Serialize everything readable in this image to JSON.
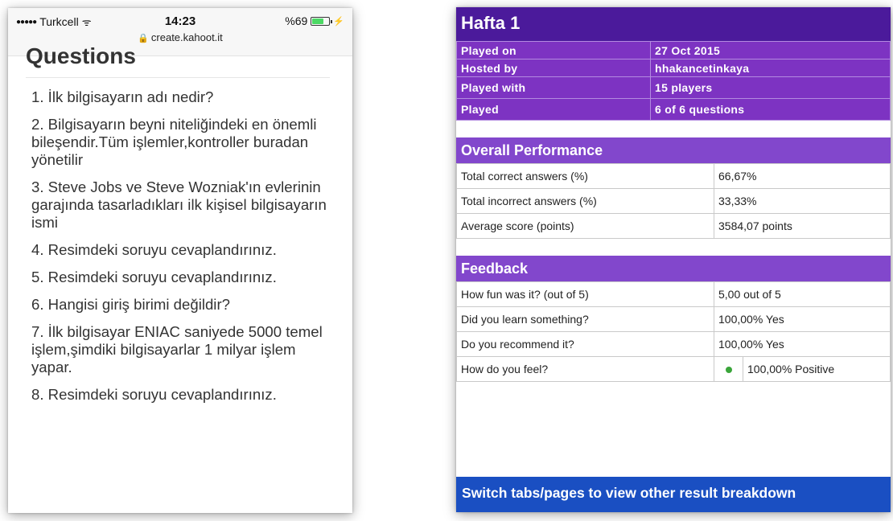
{
  "phone": {
    "status": {
      "carrier": "Turkcell",
      "time": "14:23",
      "battery": "%69",
      "battery_level": 0.69,
      "url": "create.kahoot.it"
    },
    "heading": "Questions",
    "questions": [
      "1. İlk bilgisayarın adı nedir?",
      "2. Bilgisayarın beyni niteliğindeki en önemli bileşendir.Tüm işlemler,kontroller buradan yönetilir",
      "3. Steve Jobs ve Steve Wozniak'ın evlerinin garajında tasarladıkları ilk kişisel bilgisayarın ismi",
      "4. Resimdeki soruyu cevaplandırınız.",
      "5. Resimdeki soruyu cevaplandırınız.",
      "6. Hangisi giriş birimi değildir?",
      "7. İlk bilgisayar ENIAC saniyede 5000 temel işlem,şimdiki bilgisayarlar 1 milyar işlem yapar.",
      "8. Resimdeki soruyu cevaplandırınız."
    ]
  },
  "report": {
    "title": "Hafta 1",
    "meta": [
      {
        "label": "Played on",
        "value": "27 Oct 2015"
      },
      {
        "label": "Hosted by",
        "value": "hhakancetinkaya"
      },
      {
        "label": "Played with",
        "value": "15 players"
      },
      {
        "label": "Played",
        "value": "6 of 6 questions"
      }
    ],
    "performance": {
      "title": "Overall Performance",
      "rows": [
        {
          "label": "Total correct answers (%)",
          "value": "66,67%"
        },
        {
          "label": "Total incorrect answers (%)",
          "value": "33,33%"
        },
        {
          "label": "Average score (points)",
          "value": "3584,07 points"
        }
      ]
    },
    "feedback": {
      "title": "Feedback",
      "rows": [
        {
          "label": "How fun was it? (out of 5)",
          "value": "5,00 out of 5"
        },
        {
          "label": "Did you learn something?",
          "value": "100,00% Yes"
        },
        {
          "label": "Do you recommend it?",
          "value": "100,00% Yes"
        },
        {
          "label": "How do you feel?",
          "value": "100,00% Positive",
          "icon": "smiley-icon"
        }
      ]
    },
    "footer": "Switch tabs/pages to view other result breakdown"
  },
  "colors": {
    "title_bar": "#4b1a9b",
    "meta_rows": "#7d33c2",
    "section_head": "#8247cc",
    "footer_bar": "#1a4fc2"
  }
}
